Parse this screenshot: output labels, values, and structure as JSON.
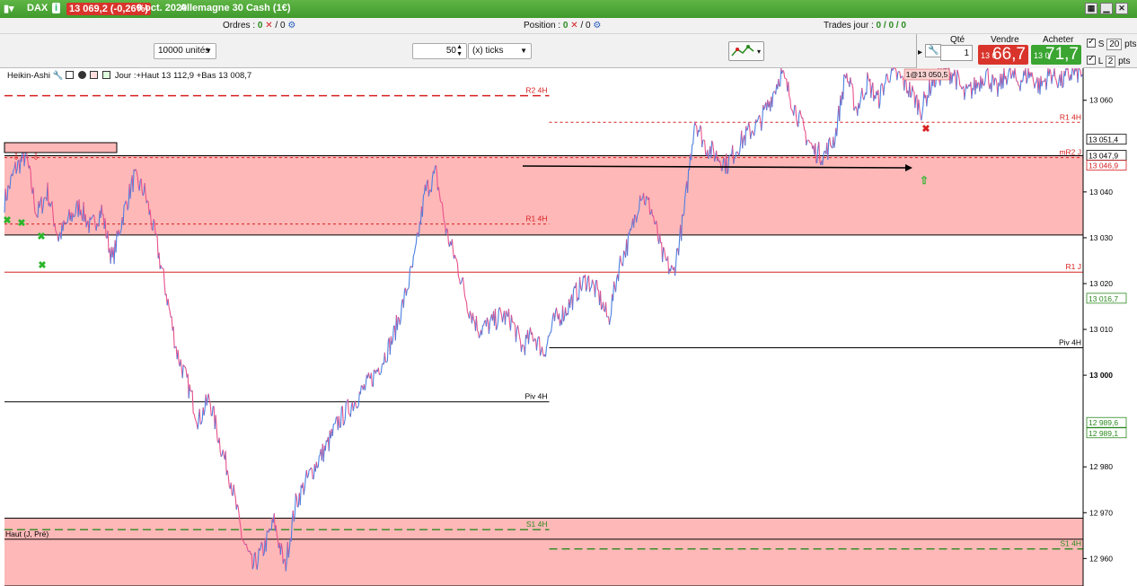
{
  "titlebar": {
    "instrument": "DAX",
    "quote": "13 069,2 (-0,26%)",
    "date": "9 oct. 2020",
    "market": "Allemagne 30 Cash (1€)"
  },
  "status": {
    "orders_label": "Ordres :",
    "orders_value": "0",
    "orders_slash": "/ 0",
    "position_label": "Position :",
    "position_value": "0",
    "position_slash": "/ 0",
    "trades_label": "Trades jour :",
    "trades_value": "0 / 0 / 0"
  },
  "toolbar": {
    "units": "10000 unités",
    "ticks_value": "50",
    "ticks_unit": "(x) ticks"
  },
  "order": {
    "qty_label": "Qté",
    "qty_value": "1",
    "sell_label": "Vendre",
    "sell_prefix": "13 0",
    "sell_price": "66,7",
    "buy_label": "Acheter",
    "buy_prefix": "13 0",
    "buy_price": "71,7",
    "s_label": "S",
    "s_value": "20",
    "l_label": "L",
    "l_value": "2",
    "pts": "pts"
  },
  "legend": {
    "indicator": "Heikin-Ashi",
    "info": "Jour :+Haut 13 112,9 +Bas 13 008,7"
  },
  "chart_data": {
    "type": "line",
    "ylim": [
      12954,
      13067
    ],
    "y_ticks": [
      {
        "value": 13060,
        "label": "13 060"
      },
      {
        "value": 13040,
        "label": "13 040"
      },
      {
        "value": 13030,
        "label": "13 030"
      },
      {
        "value": 13020,
        "label": "13 020"
      },
      {
        "value": 13010,
        "label": "13 010"
      },
      {
        "value": 13000,
        "label": "13 000"
      },
      {
        "value": 12980,
        "label": "12 980"
      },
      {
        "value": 12970,
        "label": "12 970"
      },
      {
        "value": 12960,
        "label": "12 960"
      }
    ],
    "price_tags": [
      {
        "value": 13051.4,
        "label": "13 051,4",
        "color": "#000000"
      },
      {
        "value": 13047.9,
        "label": "13 047,9",
        "color": "#000000"
      },
      {
        "value": 13046.9,
        "label": "13 046,9",
        "color": "#d72020"
      },
      {
        "value": 13016.7,
        "label": "13 016,7",
        "color": "#2b8a1f"
      },
      {
        "value": 12989.6,
        "label": "12 989,6",
        "color": "#2b8a1f"
      },
      {
        "value": 12989.1,
        "label": "12 989,1",
        "color": "#2b8a1f"
      }
    ],
    "zones": [
      {
        "from": 13030.6,
        "to": 13047.9,
        "color": "#ffb8b8"
      },
      {
        "from": 12954,
        "to": 12968.8,
        "color": "#ffb8b8"
      }
    ],
    "levels": [
      {
        "label": "R2 4H",
        "value": 13061,
        "color": "#d72020",
        "dash": "long",
        "x0": 0.0,
        "x1": 0.505,
        "label_x": 0.505
      },
      {
        "label": "R1 4H",
        "value": 13033,
        "color": "#d72020",
        "dash": "short",
        "x0": 0.0,
        "x1": 0.505,
        "label_x": 0.505
      },
      {
        "label": "R1 4H",
        "value": 13055.2,
        "color": "#d72020",
        "dash": "short",
        "x0": 0.505,
        "x1": 1.0,
        "label_x": 1.0
      },
      {
        "label": "mR2 J",
        "value": 13047.5,
        "color": "#d72020",
        "dash": "short",
        "x0": 0.0,
        "x1": 1.0,
        "label_x": 1.0
      },
      {
        "label": "R1 J",
        "value": 13022.5,
        "color": "#d72020",
        "dash": "solid",
        "x0": 0.0,
        "x1": 1.0,
        "label_x": 1.0
      },
      {
        "label": "Piv 4H",
        "value": 12994.2,
        "color": "#000000",
        "dash": "solid",
        "x0": 0.0,
        "x1": 0.505,
        "label_x": 0.505
      },
      {
        "label": "Piv 4H",
        "value": 13006,
        "color": "#000000",
        "dash": "solid",
        "x0": 0.505,
        "x1": 1.0,
        "label_x": 1.0
      },
      {
        "label": "S1 4H",
        "value": 12966.3,
        "color": "#2b8a1f",
        "dash": "long",
        "x0": 0.0,
        "x1": 0.505,
        "label_x": 0.505
      },
      {
        "label": "S1 4H",
        "value": 12962.1,
        "color": "#2b8a1f",
        "dash": "long",
        "x0": 0.505,
        "x1": 1.0,
        "label_x": 1.0
      },
      {
        "label": "Haut (J, Pré)",
        "value": 12964.2,
        "color": "#000000",
        "dash": "solid",
        "x0": 0.0,
        "x1": 1.0,
        "label_x": 0.0
      }
    ],
    "trade_label": "1@13 050,5",
    "series": [
      {
        "x": [
          0,
          0.01,
          0.02,
          0.03,
          0.04,
          0.05,
          0.06,
          0.07,
          0.08,
          0.09,
          0.1,
          0.11,
          0.12,
          0.13,
          0.14,
          0.15,
          0.16,
          0.17,
          0.18,
          0.19,
          0.2,
          0.21,
          0.22,
          0.23,
          0.24,
          0.25,
          0.26,
          0.27,
          0.28,
          0.29,
          0.3,
          0.31,
          0.32,
          0.33,
          0.34,
          0.35,
          0.36,
          0.37,
          0.38,
          0.39,
          0.4,
          0.41,
          0.42,
          0.43,
          0.44,
          0.45,
          0.46,
          0.47,
          0.48,
          0.49,
          0.5,
          0.51,
          0.52,
          0.53,
          0.54,
          0.55,
          0.56,
          0.57,
          0.58,
          0.59,
          0.6,
          0.61,
          0.62,
          0.63,
          0.64,
          0.65,
          0.66,
          0.67,
          0.68,
          0.69,
          0.7,
          0.71,
          0.72,
          0.73,
          0.74,
          0.75,
          0.76,
          0.77,
          0.78,
          0.79,
          0.8,
          0.81,
          0.82,
          0.83,
          0.84,
          0.85,
          0.86,
          0.87,
          0.88,
          0.89,
          0.9,
          0.91,
          0.92,
          0.93,
          0.94,
          0.95,
          0.96,
          0.97,
          0.98,
          0.99,
          1.0
        ],
        "y": [
          13038,
          13045,
          13048,
          13035,
          13040,
          13030,
          13034,
          13037,
          13032,
          13036,
          13025,
          13035,
          13043,
          13040,
          13030,
          13018,
          13005,
          12998,
          12990,
          12995,
          12985,
          12977,
          12965,
          12958,
          12962,
          12968,
          12958,
          12972,
          12977,
          12981,
          12985,
          12990,
          12993,
          12996,
          12999,
          13003,
          13008,
          13016,
          13025,
          13040,
          13044,
          13031,
          13024,
          13015,
          13010,
          13011,
          13013,
          13012,
          13006,
          13009,
          13005,
          13012,
          13014,
          13018,
          13021,
          13018,
          13012,
          13024,
          13030,
          13040,
          13036,
          13026,
          13022,
          13035,
          13056,
          13050,
          13048,
          13046,
          13050,
          13053,
          13055,
          13060,
          13066,
          13060,
          13054,
          13049,
          13048,
          13052,
          13066,
          13058,
          13064,
          13060,
          13066,
          13065,
          13062,
          13058,
          13064,
          13066,
          13066,
          13061,
          13063,
          13066,
          13062,
          13066,
          13064,
          13066,
          13063,
          13066,
          13064,
          13066,
          13066
        ]
      }
    ]
  }
}
